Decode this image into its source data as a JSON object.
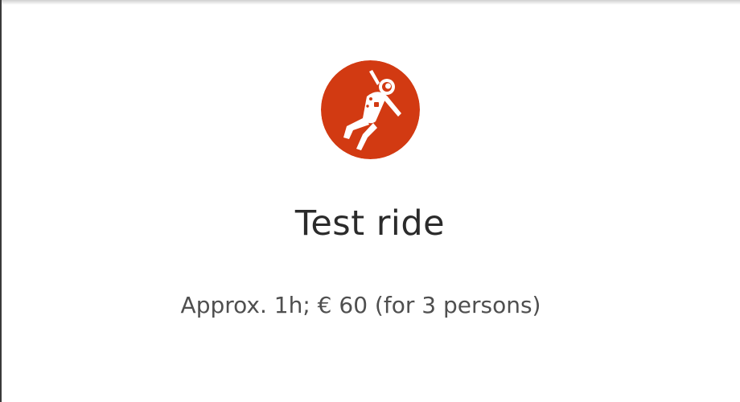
{
  "card": {
    "icon": "astronaut-icon",
    "icon_bg_color": "#D23A12",
    "title": "Test ride",
    "description": "Approx. 1h; € 60 (for 3 persons)"
  }
}
